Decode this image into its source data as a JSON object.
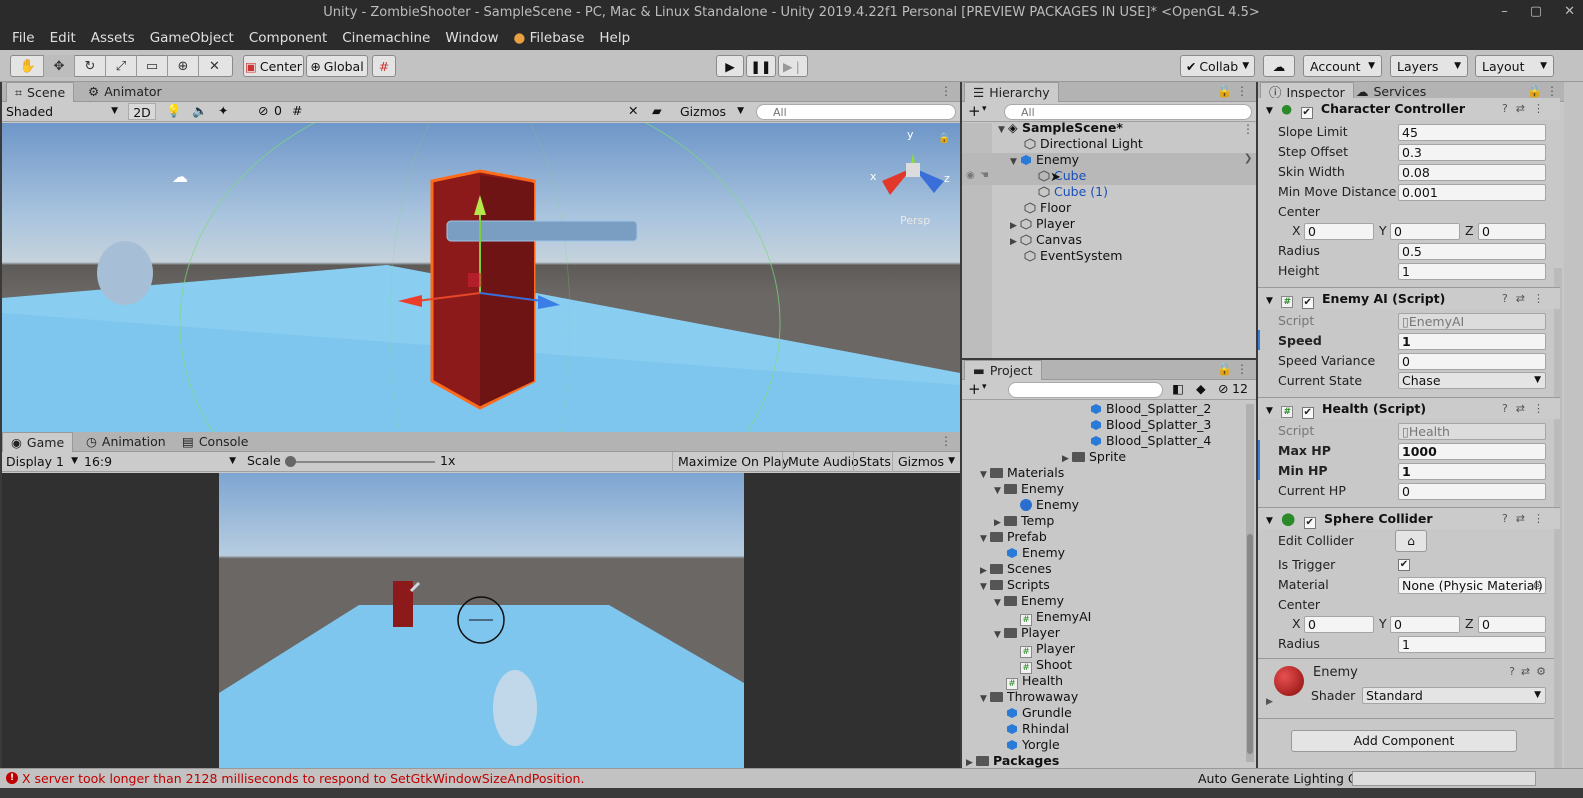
{
  "window": {
    "title": "Unity - ZombieShooter - SampleScene - PC, Mac & Linux Standalone - Unity 2019.4.22f1 Personal [PREVIEW PACKAGES IN USE]* <OpenGL 4.5>",
    "controls": [
      "–",
      "▢",
      "✕"
    ]
  },
  "menu": [
    "File",
    "Edit",
    "Assets",
    "GameObject",
    "Component",
    "Cinemachine",
    "Window",
    "Filebase",
    "Help"
  ],
  "toolbar": {
    "pivot": "Center",
    "space": "Global",
    "collab": "Collab",
    "account": "Account",
    "layers": "Layers",
    "layout": "Layout"
  },
  "scene": {
    "tabs": [
      "Scene",
      "Animator"
    ],
    "shading": "Shaded",
    "mode_2d": "2D",
    "hidden_count": "0",
    "gizmos": "Gizmos",
    "search_placeholder": "All",
    "persp": "Persp",
    "axis_y": "y",
    "axis_x": "x",
    "axis_z": "z"
  },
  "game": {
    "tabs": [
      "Game",
      "Animation",
      "Console"
    ],
    "display": "Display 1",
    "aspect": "16:9",
    "scale_label": "Scale",
    "scale_value": "1x",
    "buttons": [
      "Maximize On Play",
      "Mute Audio",
      "Stats",
      "Gizmos"
    ]
  },
  "hierarchy": {
    "tab": "Hierarchy",
    "search_placeholder": "All",
    "scene": "SampleScene*",
    "items": [
      "Directional Light",
      "Enemy",
      "Cube",
      "Cube (1)",
      "Floor",
      "Player",
      "Canvas",
      "EventSystem"
    ]
  },
  "project": {
    "tab": "Project",
    "hidden_count": "12",
    "items": [
      "Blood_Splatter_2",
      "Blood_Splatter_3",
      "Blood_Splatter_4",
      "Sprite",
      "Materials",
      "Enemy",
      "Enemy",
      "Temp",
      "Prefab",
      "Enemy",
      "Scenes",
      "Scripts",
      "Enemy",
      "EnemyAI",
      "Player",
      "Player",
      "Shoot",
      "Health",
      "Throwaway",
      "Grundle",
      "Rhindal",
      "Yorgle",
      "Packages"
    ]
  },
  "inspector": {
    "tabs": [
      "Inspector",
      "Services"
    ],
    "character_controller": {
      "title": "Character Controller",
      "slope_limit_label": "Slope Limit",
      "slope_limit": "45",
      "step_offset_label": "Step Offset",
      "step_offset": "0.3",
      "skin_width_label": "Skin Width",
      "skin_width": "0.08",
      "min_move_label": "Min Move Distance",
      "min_move": "0.001",
      "center_label": "Center",
      "cx": "0",
      "cy": "0",
      "cz": "0",
      "radius_label": "Radius",
      "radius": "0.5",
      "height_label": "Height",
      "height": "1"
    },
    "enemy_ai": {
      "title": "Enemy AI (Script)",
      "script_label": "Script",
      "script": "EnemyAI",
      "speed_label": "Speed",
      "speed": "1",
      "variance_label": "Speed Variance",
      "variance": "0",
      "state_label": "Current State",
      "state": "Chase"
    },
    "health": {
      "title": "Health (Script)",
      "script_label": "Script",
      "script": "Health",
      "max_label": "Max HP",
      "max": "1000",
      "min_label": "Min HP",
      "min": "1",
      "current_label": "Current HP",
      "current": "0"
    },
    "sphere_collider": {
      "title": "Sphere Collider",
      "edit_label": "Edit Collider",
      "trigger_label": "Is Trigger",
      "material_label": "Material",
      "material": "None (Physic Material)",
      "center_label": "Center",
      "cx": "0",
      "cy": "0",
      "cz": "0",
      "radius_label": "Radius",
      "radius": "1"
    },
    "material": {
      "name": "Enemy",
      "shader_label": "Shader",
      "shader": "Standard"
    },
    "add_component": "Add Component",
    "x": "X",
    "y": "Y",
    "z": "Z"
  },
  "status": {
    "message": "X server took longer than 2128 milliseconds to respond to SetGtkWindowSizeAndPosition.",
    "lighting": "Auto Generate Lighting Off"
  },
  "colors": {
    "selection_text": "#1a4fb8",
    "error_red": "#c00000",
    "enemy_red": "#8c1a1a"
  }
}
